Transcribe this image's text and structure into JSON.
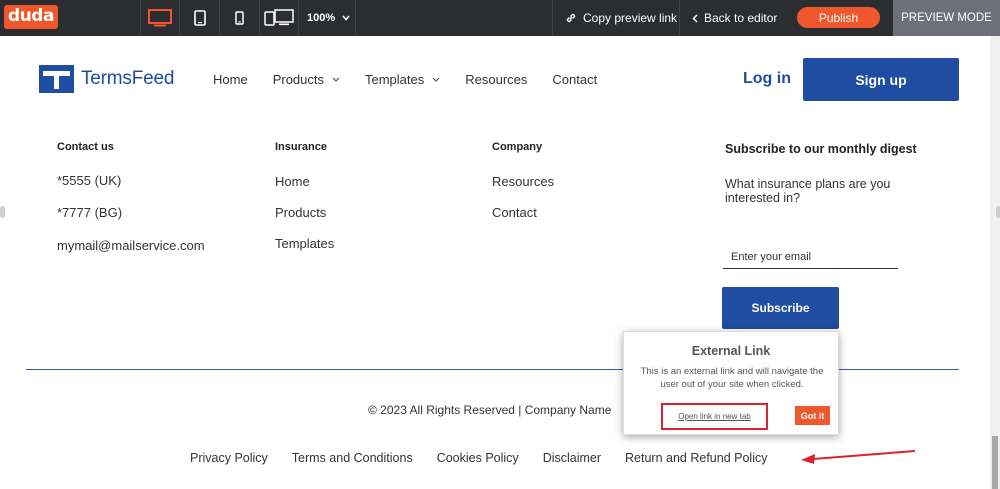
{
  "toolbar": {
    "logo": "duda",
    "zoom": "100%",
    "copy_preview": "Copy preview link",
    "back_to_editor": "Back to editor",
    "publish": "Publish",
    "preview_mode": "PREVIEW MODE",
    "accent": "#f0572d"
  },
  "site": {
    "brand": "TermsFeed",
    "brand_color": "#1e4da1",
    "nav": {
      "home": "Home",
      "products": "Products",
      "templates": "Templates",
      "resources": "Resources",
      "contact": "Contact"
    },
    "login": "Log in",
    "signup": "Sign up"
  },
  "footer": {
    "contact": {
      "title": "Contact us",
      "phone_uk": "*5555 (UK)",
      "phone_bg": "*7777 (BG)",
      "email": "mymail@mailservice.com"
    },
    "insurance": {
      "title": "Insurance",
      "home": "Home",
      "products": "Products",
      "templates": "Templates"
    },
    "company": {
      "title": "Company",
      "resources": "Resources",
      "contact": "Contact"
    },
    "subscribe": {
      "title": "Subscribe to our monthly digest",
      "question": "What insurance plans are you interested in?",
      "placeholder": "Enter your email",
      "button": "Subscribe"
    },
    "copyright": "© 2023 All Rights Reserved | Company Name",
    "links": {
      "privacy": "Privacy Policy",
      "terms": "Terms and Conditions",
      "cookies": "Cookies Policy",
      "disclaimer": "Disclaimer",
      "refund": "Return and Refund Policy"
    }
  },
  "popup": {
    "title": "External Link",
    "message": "This is an external link and will navigate the user out of your site when clicked.",
    "open_link": "Open link in new tab",
    "got_it": "Got it"
  }
}
